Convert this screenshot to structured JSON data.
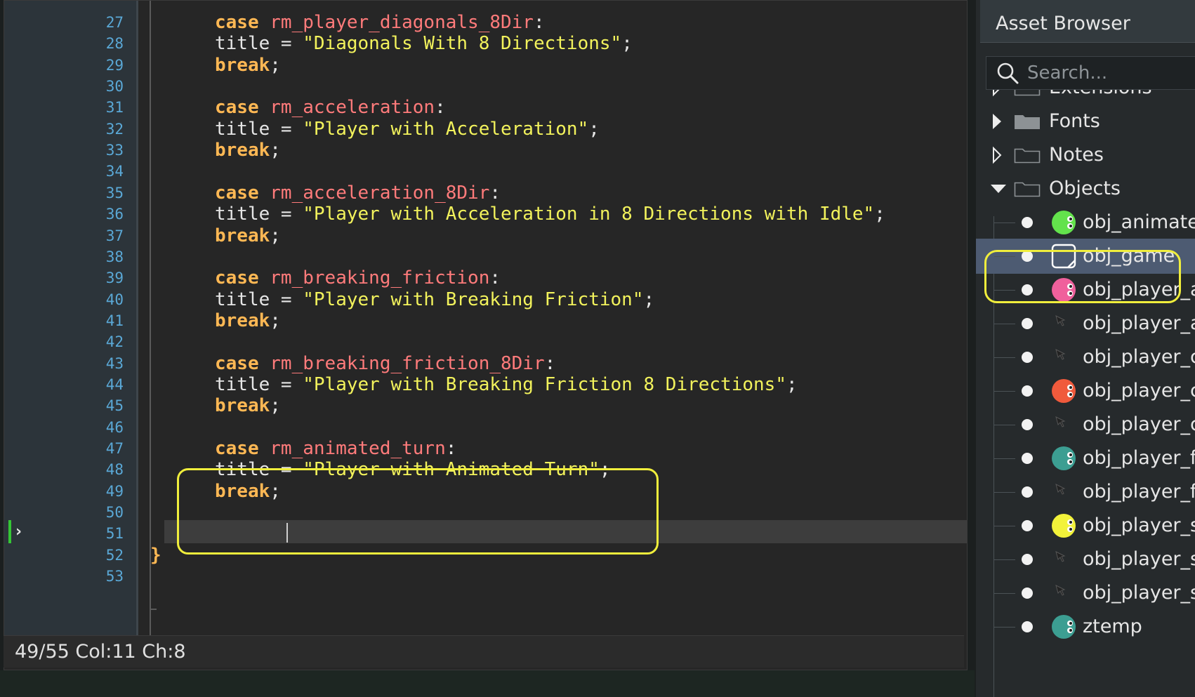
{
  "editor": {
    "lines": [
      {
        "num": "27",
        "keyword": "case",
        "ident": "rm_player_diagonals_8Dir",
        "punct": ":"
      },
      {
        "num": "28",
        "prefix": "title = ",
        "string": "\"Diagonals With 8 Directions\"",
        "punct": ";"
      },
      {
        "num": "29",
        "keyword": "break",
        "punct": ";"
      },
      {
        "num": "30"
      },
      {
        "num": "31",
        "keyword": "case",
        "ident": "rm_acceleration",
        "punct": ":"
      },
      {
        "num": "32",
        "prefix": "title = ",
        "string": "\"Player with Acceleration\"",
        "punct": ";"
      },
      {
        "num": "33",
        "keyword": "break",
        "punct": ";"
      },
      {
        "num": "34"
      },
      {
        "num": "35",
        "keyword": "case",
        "ident": "rm_acceleration_8Dir",
        "punct": ":"
      },
      {
        "num": "36",
        "prefix": "title = ",
        "string": "\"Player with Acceleration in 8 Directions with Idle\"",
        "punct": ";"
      },
      {
        "num": "37",
        "keyword": "break",
        "punct": ";"
      },
      {
        "num": "38"
      },
      {
        "num": "39",
        "keyword": "case",
        "ident": "rm_breaking_friction",
        "punct": ":"
      },
      {
        "num": "40",
        "prefix": "title = ",
        "string": "\"Player with Breaking Friction\"",
        "punct": ";"
      },
      {
        "num": "41",
        "keyword": "break",
        "punct": ";"
      },
      {
        "num": "42"
      },
      {
        "num": "43",
        "keyword": "case",
        "ident": "rm_breaking_friction_8Dir",
        "punct": ":"
      },
      {
        "num": "44",
        "prefix": "title = ",
        "string": "\"Player with Breaking Friction 8 Directions\"",
        "punct": ";"
      },
      {
        "num": "45",
        "keyword": "break",
        "punct": ";"
      },
      {
        "num": "46"
      },
      {
        "num": "47",
        "keyword": "case",
        "ident": "rm_animated_turn",
        "punct": ":"
      },
      {
        "num": "48",
        "prefix": "title = ",
        "string": "\"Player with Animated Turn\"",
        "punct": ";"
      },
      {
        "num": "49",
        "keyword": "break",
        "punct": ";"
      },
      {
        "num": "50"
      },
      {
        "num": "51"
      },
      {
        "num": "52",
        "brace": "}"
      },
      {
        "num": "53"
      }
    ],
    "current_line_marker": "›"
  },
  "status_bar": {
    "text": "49/55 Col:11 Ch:8"
  },
  "asset_browser": {
    "title": "Asset Browser",
    "search_placeholder": "Search...",
    "folders": [
      {
        "label": "Extensions",
        "state": "collapsed"
      },
      {
        "label": "Fonts",
        "state": "collapsed-filled"
      },
      {
        "label": "Notes",
        "state": "collapsed"
      },
      {
        "label": "Objects",
        "state": "expanded"
      }
    ],
    "objects": [
      {
        "label": "obj_animate",
        "icon": "green-ball-icon",
        "color": "#63e24c"
      },
      {
        "label": "obj_game",
        "icon": "empty-sprite-icon",
        "color": "#ffffff",
        "selected": true
      },
      {
        "label": "obj_player_a",
        "icon": "pink-ball-icon",
        "color": "#f0609c"
      },
      {
        "label": "obj_player_a",
        "icon": "arrow-sprite-icon",
        "color": "#222222"
      },
      {
        "label": "obj_player_c",
        "icon": "arrow-sprite-icon",
        "color": "#222222"
      },
      {
        "label": "obj_player_c",
        "icon": "orange-ball-icon",
        "color": "#f05a3c"
      },
      {
        "label": "obj_player_c",
        "icon": "arrow-sprite-icon",
        "color": "#222222"
      },
      {
        "label": "obj_player_f",
        "icon": "teal-ball-icon",
        "color": "#3c9e92"
      },
      {
        "label": "obj_player_f",
        "icon": "arrow-sprite-icon",
        "color": "#222222"
      },
      {
        "label": "obj_player_s",
        "icon": "yellow-ball-icon",
        "color": "#f2f23a"
      },
      {
        "label": "obj_player_s",
        "icon": "arrow-sprite-icon",
        "color": "#222222"
      },
      {
        "label": "obj_player_s",
        "icon": "arrow-sprite-icon",
        "color": "#222222"
      },
      {
        "label": "ztemp",
        "icon": "teal-ball-icon",
        "color": "#3c9e92"
      }
    ]
  },
  "colors": {
    "keyword": "#ffb854",
    "identifier": "#ff7b7b",
    "string": "#f2f25c",
    "line_number": "#5aa8d6",
    "highlight": "#f0ee3c",
    "selection": "#4d5b72"
  }
}
